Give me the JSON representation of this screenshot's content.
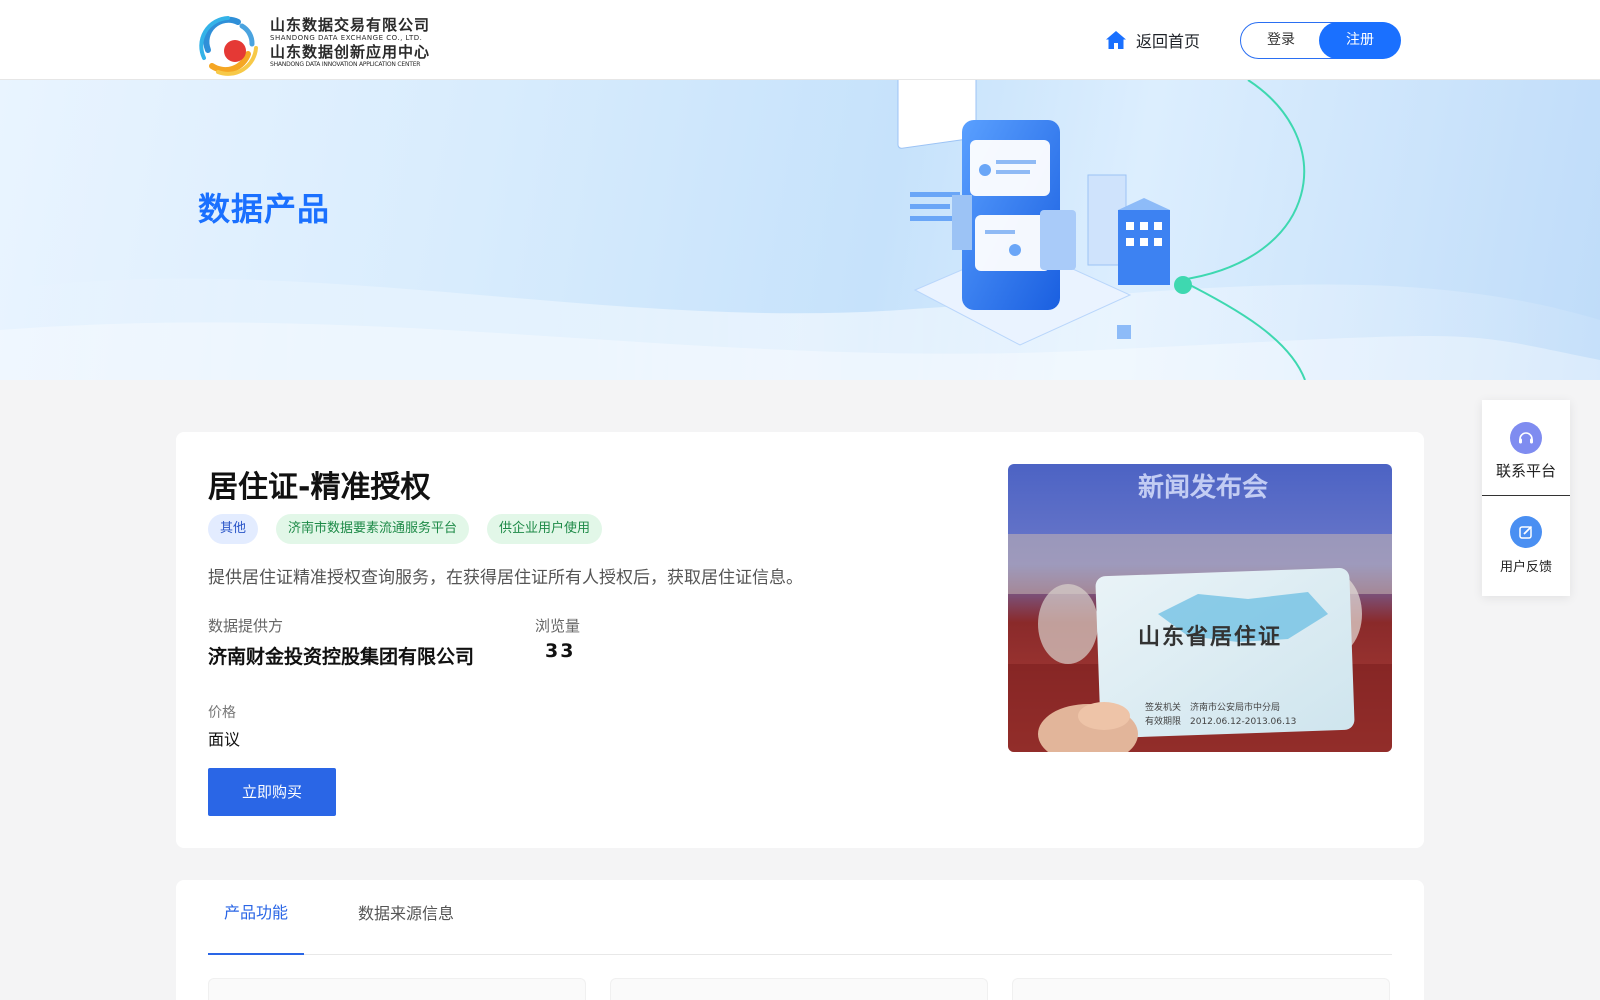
{
  "header": {
    "logo": {
      "line1_cn": "山东数据交易有限公司",
      "line1_en": "SHANDONG DATA EXCHANGE CO., LTD.",
      "line2_cn": "山东数据创新应用中心",
      "line2_en": "SHANDONG DATA INNOVATION APPLICATION CENTER"
    },
    "home_label": "返回首页",
    "login_label": "登录",
    "register_label": "注册"
  },
  "banner": {
    "title": "数据产品"
  },
  "side_panel": {
    "contact_label": "联系平台",
    "feedback_label": "用户反馈"
  },
  "product": {
    "title": "居住证-精准授权",
    "tags": [
      "其他",
      "济南市数据要素流通服务平台",
      "供企业用户使用"
    ],
    "description": "提供居住证精准授权查询服务，在获得居住证所有人授权后，获取居住证信息。",
    "provider_label": "数据提供方",
    "provider_value": "济南财金投资控股集团有限公司",
    "views_label": "浏览量",
    "views_value": "33",
    "price_label": "价格",
    "price_value": "面议",
    "buy_label": "立即购买",
    "image": {
      "backdrop_text": "新闻发布会",
      "card_title": "山东省居住证",
      "card_line1": "签发机关　济南市公安局市中分局",
      "card_line2": "有效期限　2012.06.12-2013.06.13"
    }
  },
  "tabs": {
    "items": [
      "产品功能",
      "数据来源信息"
    ],
    "active_index": 0
  },
  "colors": {
    "primary": "#1a70ff",
    "button": "#2a66e6",
    "tag_blue_bg": "#e3ecff",
    "tag_green_bg": "#e2f7e8"
  }
}
